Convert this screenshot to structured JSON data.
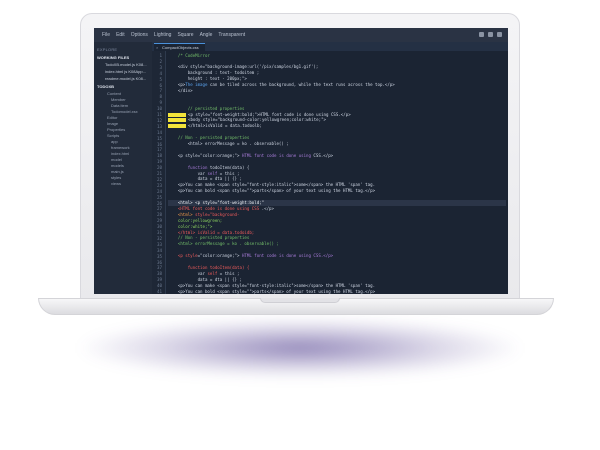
{
  "menu": [
    "File",
    "Edit",
    "Options",
    "Lighting",
    "Square",
    "Angle",
    "Transparent"
  ],
  "sidebar": {
    "title": "EXPLORE",
    "working_files_label": "WORKING FILES",
    "files": [
      "TodoXB.model.js  K08...",
      "index.html js  K08App...",
      "readme.model.js  K08..."
    ],
    "tree_label": "TODOXB",
    "nodes": [
      {
        "label": "Content",
        "deep": false
      },
      {
        "label": "Member",
        "deep": true
      },
      {
        "label": "Data item",
        "deep": true
      },
      {
        "label": "Todomodel.xsx",
        "deep": true
      },
      {
        "label": "Editor",
        "deep": false
      },
      {
        "label": "Image",
        "deep": false
      },
      {
        "label": "Properties",
        "deep": false
      },
      {
        "label": "Scripts",
        "deep": false
      },
      {
        "label": "app",
        "deep": true
      },
      {
        "label": "framework",
        "deep": true
      },
      {
        "label": "index.html",
        "deep": true
      },
      {
        "label": "model",
        "deep": true
      },
      {
        "label": "models",
        "deep": true
      },
      {
        "label": "main.js",
        "deep": true
      },
      {
        "label": "styles",
        "deep": true
      },
      {
        "label": "views",
        "deep": true
      }
    ]
  },
  "tab": {
    "label": "CompactObjects.css",
    "close": "×"
  },
  "lines": [
    {
      "n": "1",
      "parts": [
        {
          "c": "comment",
          "t": "    /* CodeMirror"
        }
      ]
    },
    {
      "n": "2",
      "parts": []
    },
    {
      "n": "3",
      "parts": [
        {
          "c": "default",
          "t": "    <div style=\"background-image:url('/pix/samples/bg1.gif');"
        }
      ]
    },
    {
      "n": "4",
      "parts": [
        {
          "c": "default",
          "t": "        background : text- todoitem ;"
        }
      ]
    },
    {
      "n": "5",
      "parts": [
        {
          "c": "default",
          "t": "        height : text - 200px;\">"
        }
      ]
    },
    {
      "n": "6",
      "parts": [
        {
          "c": "default",
          "t": "    <p>"
        },
        {
          "c": "blue",
          "t": "The image"
        },
        {
          "c": "default",
          "t": " can be tiled across the background, while the text runs across the top.</p>"
        }
      ]
    },
    {
      "n": "7",
      "parts": [
        {
          "c": "default",
          "t": "    </div>"
        }
      ]
    },
    {
      "n": "8",
      "parts": []
    },
    {
      "n": "9",
      "parts": []
    },
    {
      "n": "10",
      "parts": [
        {
          "c": "comment",
          "t": "        // persisted properties"
        }
      ]
    },
    {
      "n": "11",
      "parts": [
        {
          "c": "ylw",
          "t": ""
        },
        {
          "c": "default",
          "t": "<p style=\"font-weight:bold;\">HTML font code is done using CSS.</p>"
        }
      ]
    },
    {
      "n": "12",
      "parts": [
        {
          "c": "ylw",
          "t": ""
        },
        {
          "c": "default",
          "t": "<body style=\"background-color:yellowgreen;color:white;\">"
        }
      ]
    },
    {
      "n": "13",
      "parts": [
        {
          "c": "ylw",
          "t": ""
        },
        {
          "c": "default",
          "t": "</html>isValid = data.todoolb;"
        }
      ]
    },
    {
      "n": "14",
      "parts": []
    },
    {
      "n": "15",
      "parts": [
        {
          "c": "comment",
          "t": "    // Non - persisted properties"
        }
      ]
    },
    {
      "n": "16",
      "parts": [
        {
          "c": "default",
          "t": "        <html> errorMessage = ko . observable() ;"
        }
      ]
    },
    {
      "n": "17",
      "parts": []
    },
    {
      "n": "18",
      "parts": [
        {
          "c": "default",
          "t": "    <p style=\"color:orange;\"> "
        },
        {
          "c": "purple",
          "t": "HTML font code is done using"
        },
        {
          "c": "default",
          "t": " CSS.</p>"
        }
      ]
    },
    {
      "n": "19",
      "parts": []
    },
    {
      "n": "20",
      "parts": [
        {
          "c": "default",
          "t": "        "
        },
        {
          "c": "purple",
          "t": "function"
        },
        {
          "c": "default",
          "t": " todoItem(data) {"
        }
      ]
    },
    {
      "n": "21",
      "parts": [
        {
          "c": "default",
          "t": "            var "
        },
        {
          "c": "purple",
          "t": "self"
        },
        {
          "c": "default",
          "t": " = this ;"
        }
      ]
    },
    {
      "n": "22",
      "parts": [
        {
          "c": "default",
          "t": "            data = dta || {} ;"
        }
      ]
    },
    {
      "n": "23",
      "parts": [
        {
          "c": "default",
          "t": "    <p>You can make <span style=\"font-style:italic\">some</span> the HTML 'span' tag."
        }
      ]
    },
    {
      "n": "24",
      "parts": [
        {
          "c": "default",
          "t": "    <p>You can bold <span style=\"\">parts</span> of your text using the HTML tag.</p>"
        }
      ]
    },
    {
      "n": "25",
      "parts": []
    },
    {
      "n": "26",
      "parts": [
        {
          "c": "white",
          "t": "    <html> <p style=\"font-weight:bold;\""
        }
      ],
      "hl": true
    },
    {
      "n": "27",
      "parts": [
        {
          "c": "red",
          "t": "    <HTML font code is done using CSS"
        },
        {
          "c": "default",
          "t": " .</p>"
        }
      ]
    },
    {
      "n": "28",
      "parts": [
        {
          "c": "orange",
          "t": "    <html>"
        },
        {
          "c": "red",
          "t": " style=\"background-"
        }
      ]
    },
    {
      "n": "29",
      "parts": [
        {
          "c": "green",
          "t": "    color:yellowgreen;"
        }
      ]
    },
    {
      "n": "30",
      "parts": [
        {
          "c": "green",
          "t": "    color:white;\">"
        }
      ]
    },
    {
      "n": "31",
      "parts": [
        {
          "c": "red",
          "t": "    </html> isValid = data.todoidb;"
        }
      ]
    },
    {
      "n": "32",
      "parts": [
        {
          "c": "comment",
          "t": "    // Non - persisted properties"
        }
      ]
    },
    {
      "n": "33",
      "parts": [
        {
          "c": "comment",
          "t": "    <html> errorMessage = ko . observable() ;"
        }
      ]
    },
    {
      "n": "34",
      "parts": []
    },
    {
      "n": "35",
      "parts": [
        {
          "c": "red",
          "t": "    <p style"
        },
        {
          "c": "default",
          "t": "=\"color:orange;\"> "
        },
        {
          "c": "purple",
          "t": "HTML font code is done using CSS.</p>"
        }
      ]
    },
    {
      "n": "36",
      "parts": []
    },
    {
      "n": "37",
      "parts": [
        {
          "c": "red",
          "t": "        function todoItem(data) {"
        }
      ]
    },
    {
      "n": "38",
      "parts": [
        {
          "c": "default",
          "t": "            var "
        },
        {
          "c": "red",
          "t": "self"
        },
        {
          "c": "default",
          "t": " = this ;"
        }
      ]
    },
    {
      "n": "39",
      "parts": [
        {
          "c": "default",
          "t": "            data = dta || {} ;"
        }
      ]
    },
    {
      "n": "40",
      "parts": [
        {
          "c": "default",
          "t": "    <p>You can make <span style=\"font-style:italic\">some</span> the HTML 'span' tag."
        }
      ]
    },
    {
      "n": "41",
      "parts": [
        {
          "c": "default",
          "t": "    <p>You can bold <span style=\"\">parts</span> of your text using the HTML tag.</p>"
        }
      ]
    }
  ],
  "colors": {
    "screen_bg": "#1b2433",
    "comment": "#74c06a",
    "highlight_marker": "#f3e43a",
    "keyword": "#a77bd8",
    "error": "#ef5b5b"
  }
}
